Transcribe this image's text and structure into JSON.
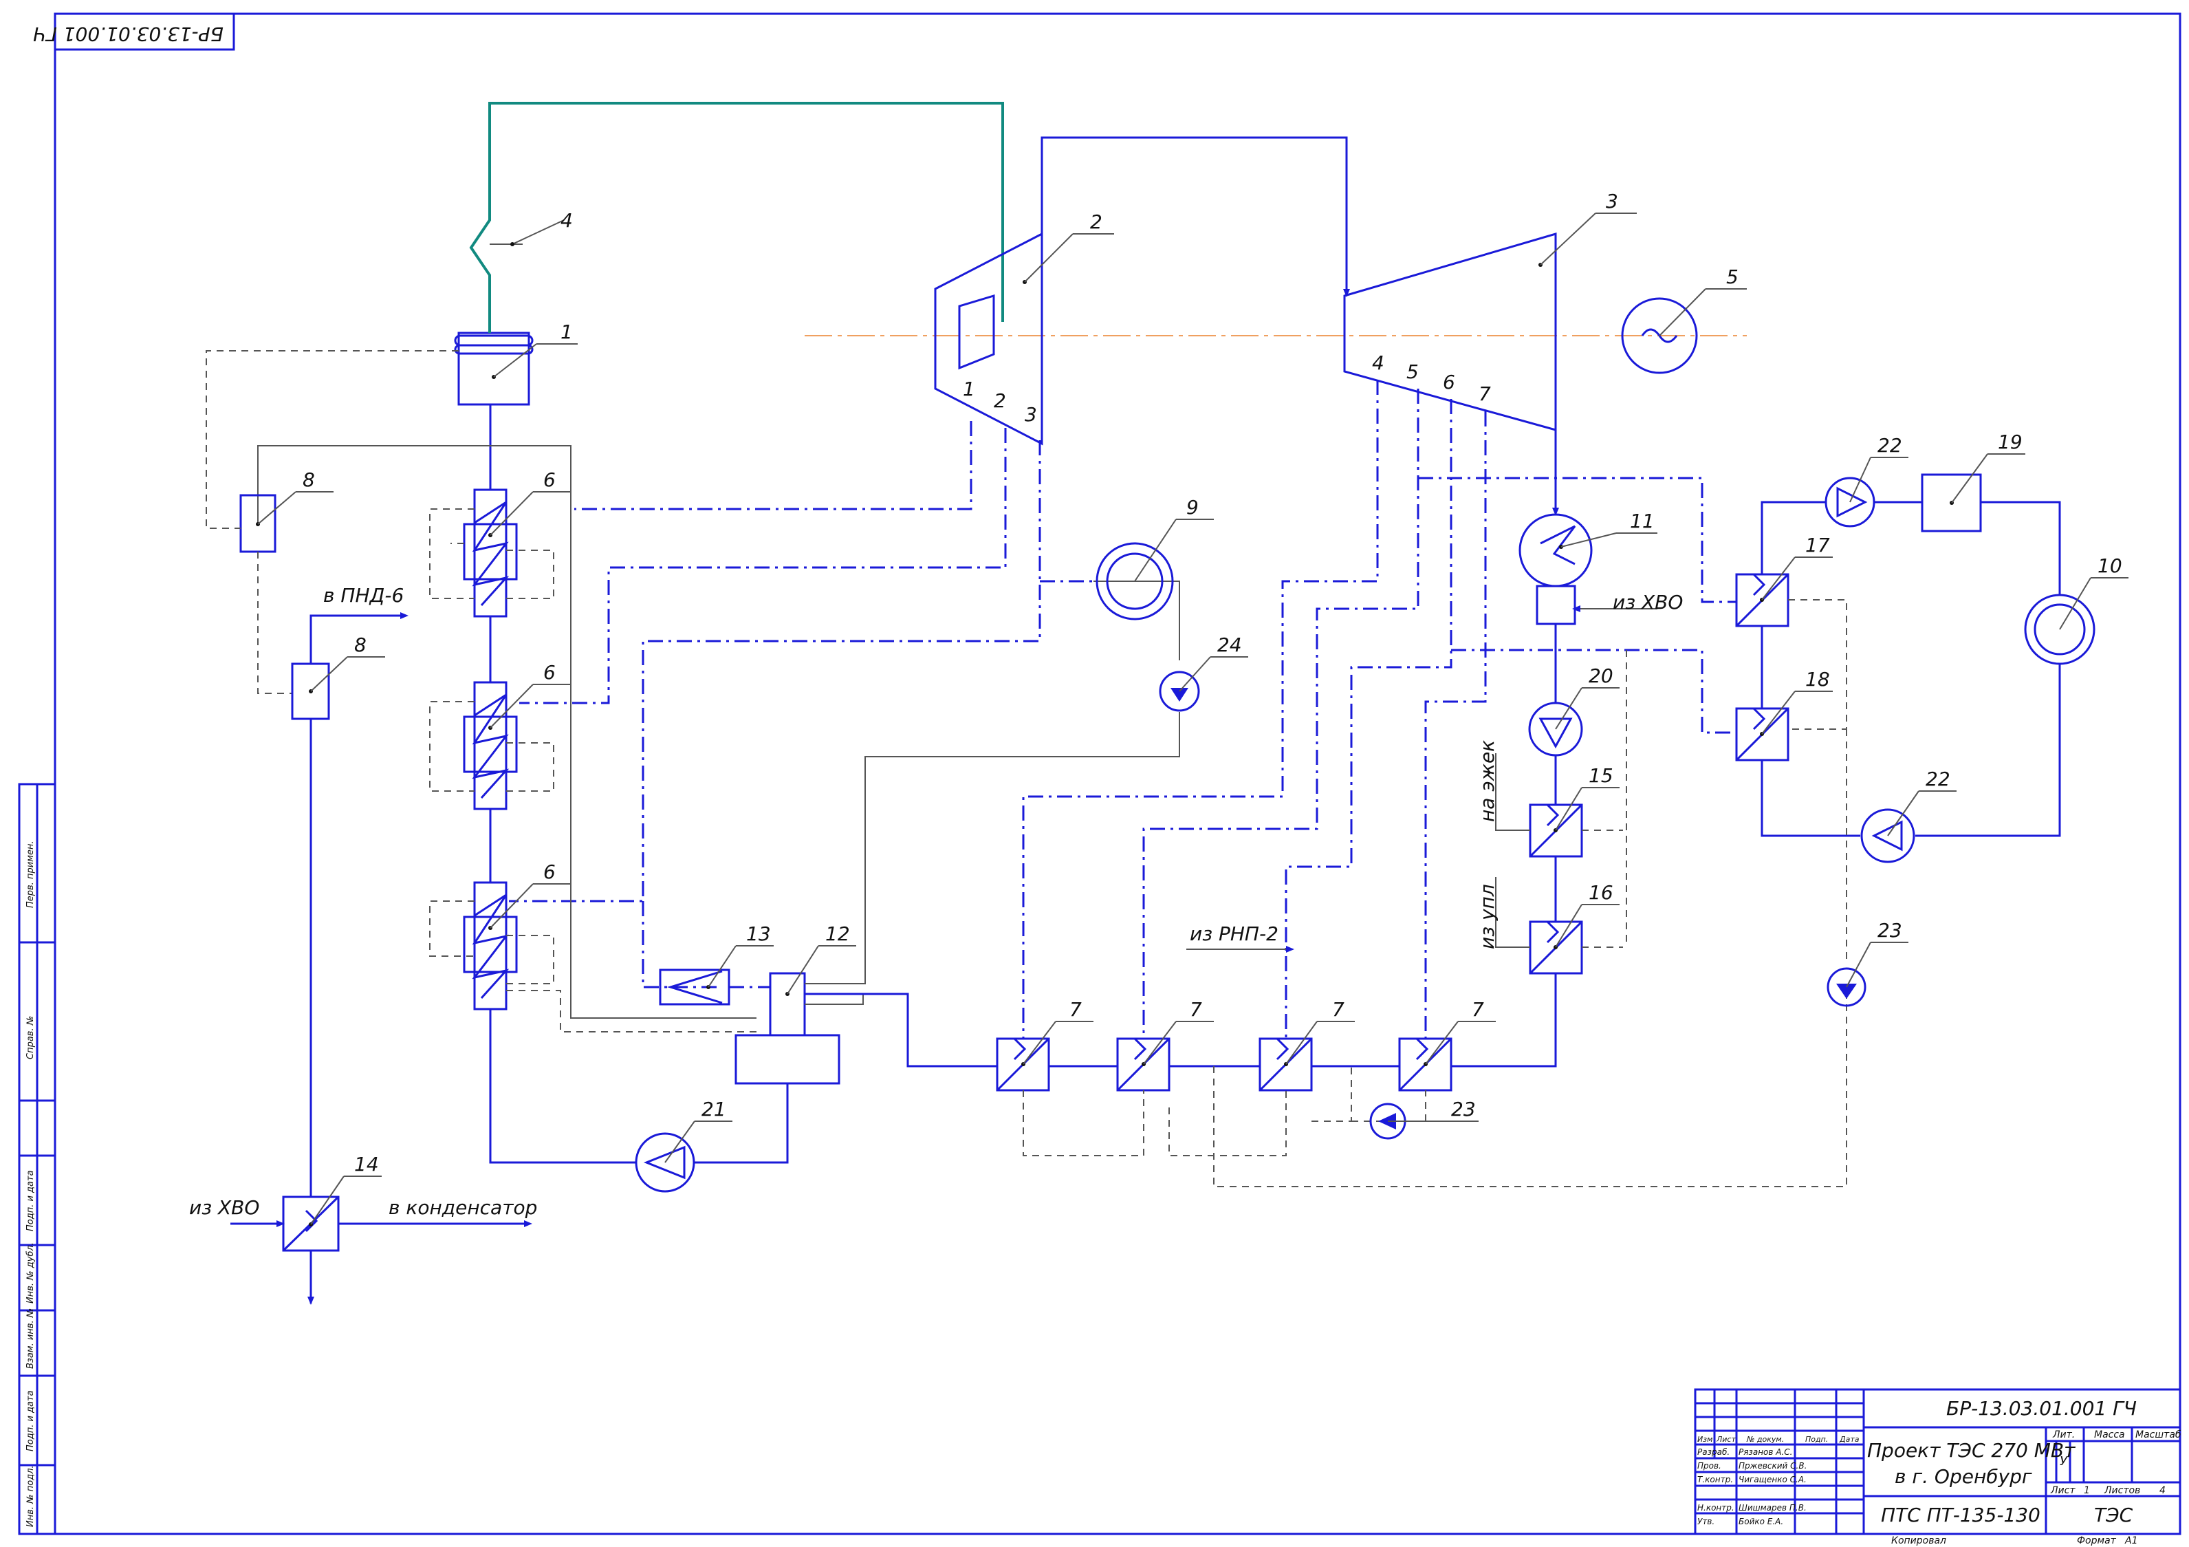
{
  "stamp_top": "БР-13.03.01.001 ГЧ",
  "labels": {
    "n1": "1",
    "n2": "2",
    "n3": "3",
    "n4": "4",
    "n5": "5",
    "n6a": "6",
    "n6b": "6",
    "n6c": "6",
    "n7a": "7",
    "n7b": "7",
    "n7c": "7",
    "n7d": "7",
    "n8a": "8",
    "n8b": "8",
    "n9": "9",
    "n10": "10",
    "n11": "11",
    "n12": "12",
    "n13": "13",
    "n14": "14",
    "n15": "15",
    "n16": "16",
    "n17": "17",
    "n18": "18",
    "n19": "19",
    "n20": "20",
    "n21": "21",
    "n22a": "22",
    "n22b": "22",
    "n23a": "23",
    "n23b": "23",
    "n24": "24"
  },
  "extractions": {
    "hp": [
      "1",
      "2",
      "3"
    ],
    "lp": [
      "4",
      "5",
      "6",
      "7"
    ]
  },
  "annotations": {
    "to_pnd6": "в ПНД-6",
    "from_hvo_cond": "из ХВО",
    "from_hvo_left": "из ХВО",
    "to_condenser": "в конденсатор",
    "from_rnp2": "из РНП-2",
    "to_ejector": "на эжек",
    "from_upl": "из упл"
  },
  "side_strip": [
    "Перв. примен.",
    "Справ. №",
    "Подп. и дата",
    "Инв. № дубл.",
    "Взам. инв. №",
    "Подп. и дата",
    "Инв. № подл."
  ],
  "title_block": {
    "code": "БР-13.03.01.001 ГЧ",
    "project_line1": "Проект ТЭС 270 МВт",
    "project_line2": "в г. Оренбург",
    "drawing_name": "ПТС ПТ-135-130",
    "org": "ТЭС",
    "lit_header": "Лит.",
    "mass_header": "Масса",
    "scale_header": "Масштаб",
    "lit_value": "У",
    "sheet_label": "Лист",
    "sheet_value": "1",
    "sheets_label": "Листов",
    "sheets_value": "4",
    "col_izm": "Изм",
    "col_list": "Лист",
    "col_doc": "№ докум.",
    "col_sign": "Подп.",
    "col_date": "Дата",
    "roles": [
      {
        "role": "Разраб.",
        "name": "Рязанов А.С."
      },
      {
        "role": "Пров.",
        "name": "Пржевский С.В."
      },
      {
        "role": "Т.контр.",
        "name": "Чигащенко С.А."
      },
      {
        "role": "",
        "name": ""
      },
      {
        "role": "Н.контр.",
        "name": "Шишмарев П.В."
      },
      {
        "role": "Утв.",
        "name": "Бойко Е.А."
      }
    ],
    "copied": "Копировал",
    "format_label": "Формат",
    "format_value": "А1"
  }
}
